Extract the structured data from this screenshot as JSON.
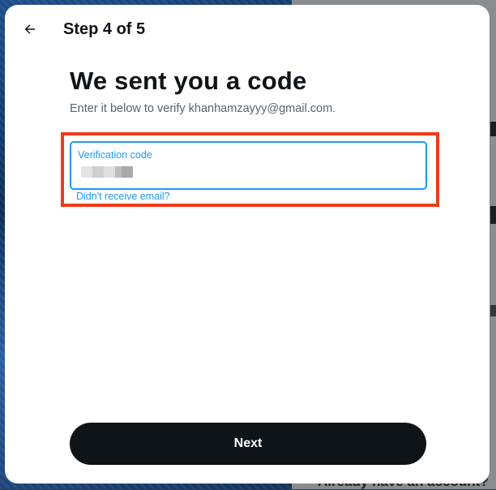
{
  "header": {
    "back_icon": "arrow-left-icon",
    "step_label": "Step 4 of 5"
  },
  "main": {
    "title": "We sent you a code",
    "subtitle": "Enter it below to verify khanhamzayyy@gmail.com.",
    "verification_field": {
      "label": "Verification code",
      "value_state": "redacted (blurred)"
    },
    "resend_link": "Didn't receive email?"
  },
  "footer": {
    "next_label": "Next"
  },
  "background": {
    "partial_text": "Already have an account?"
  },
  "colors": {
    "accent": "#1d9bf0",
    "text_primary": "#0f1419",
    "text_secondary": "#536471",
    "highlight": "#f23a1a",
    "button_bg": "#0f1419"
  }
}
